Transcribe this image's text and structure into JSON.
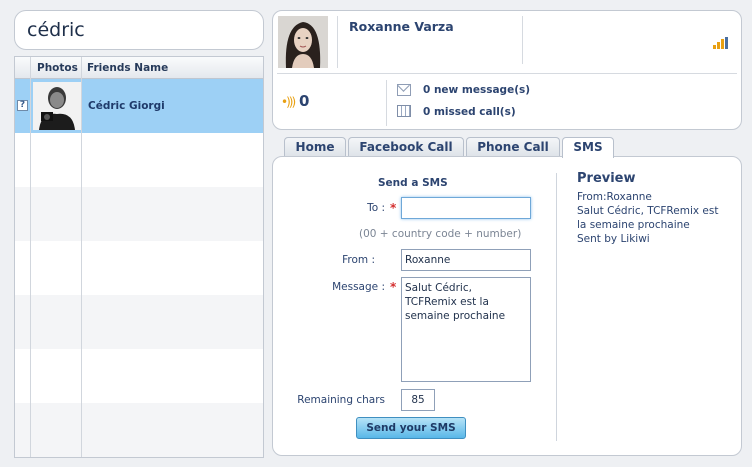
{
  "search": {
    "value": "cédric"
  },
  "friends_table": {
    "headers": {
      "photos": "Photos",
      "name": "Friends Name"
    },
    "rows": [
      {
        "badge": "?",
        "name": "Cédric Giorgi",
        "selected": true
      }
    ]
  },
  "profile": {
    "name": "Roxanne Varza",
    "online_count": "0",
    "new_messages": "0 new message(s)",
    "missed_calls": "0 missed call(s)"
  },
  "tabs": [
    {
      "label": "Home",
      "active": false
    },
    {
      "label": "Facebook Call",
      "active": false
    },
    {
      "label": "Phone Call",
      "active": false
    },
    {
      "label": "SMS",
      "active": true
    }
  ],
  "sms_form": {
    "title": "Send a SMS",
    "to_label": "To :",
    "required_mark": "*",
    "to_value": "",
    "to_hint": "(00 + country code + number)",
    "from_label": "From :",
    "from_value": "Roxanne",
    "message_label": "Message :",
    "message_value": "Salut Cédric,\nTCFRemix est la\nsemaine prochaine",
    "remaining_label": "Remaining chars",
    "remaining_value": "85",
    "send_label": "Send your SMS"
  },
  "preview": {
    "title": "Preview",
    "lines": [
      "From:Roxanne",
      "Salut Cédric, TCFRemix est",
      "la semaine prochaine",
      "Sent by Likiwi"
    ]
  },
  "colors": {
    "selected_row": "#9dd0f5",
    "accent_text": "#2c4470",
    "required": "#d43030",
    "send_button": "#59b7e8",
    "signal_bars": "#e8a012"
  },
  "icons": [
    "question-badge-icon",
    "online-signal-icon",
    "envelope-icon",
    "calendar-icon",
    "signal-bars-icon"
  ]
}
